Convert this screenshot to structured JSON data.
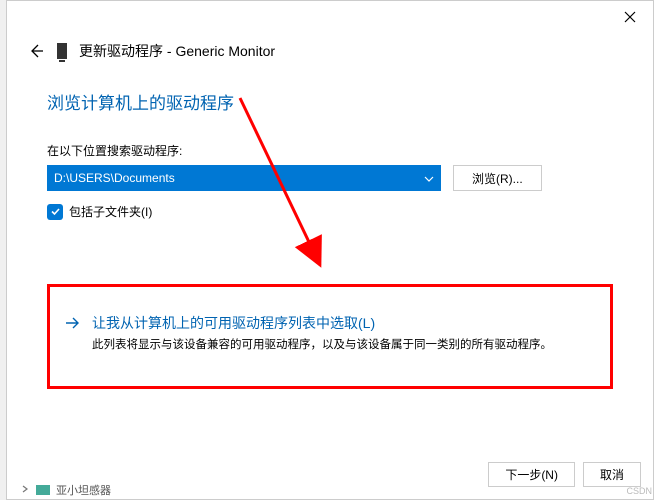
{
  "header": {
    "title": "更新驱动程序 - Generic Monitor"
  },
  "main": {
    "heading": "浏览计算机上的驱动程序",
    "search_label": "在以下位置搜索驱动程序:",
    "path_value": "D:\\USERS\\Documents",
    "browse_label": "浏览(R)...",
    "checkbox_label": "包括子文件夹(I)"
  },
  "option": {
    "title": "让我从计算机上的可用驱动程序列表中选取(L)",
    "description": "此列表将显示与该设备兼容的可用驱动程序，以及与该设备属于同一类别的所有驱动程序。"
  },
  "footer": {
    "next": "下一步(N)",
    "cancel": "取消"
  },
  "behind": {
    "text": "亚小坦感器"
  },
  "watermark": "CSDN"
}
